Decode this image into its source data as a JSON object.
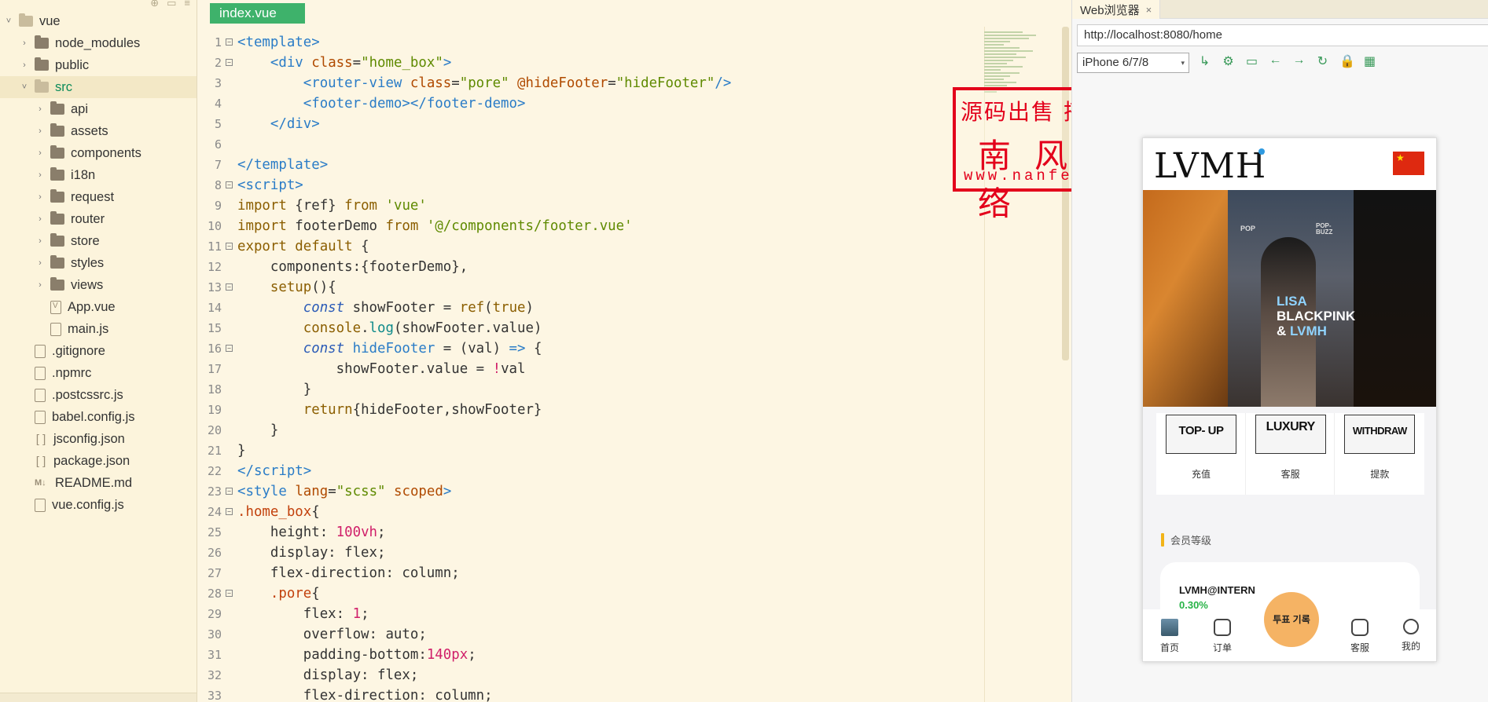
{
  "file_tree": {
    "root": "vue",
    "items": [
      {
        "label": "node_modules",
        "kind": "folder",
        "depth": 1,
        "icon": "folder-icon"
      },
      {
        "label": "public",
        "kind": "folder",
        "depth": 1,
        "icon": "folder-icon"
      },
      {
        "label": "src",
        "kind": "folder-open",
        "depth": 1,
        "icon": "folder-open-icon"
      },
      {
        "label": "api",
        "kind": "folder",
        "depth": 2,
        "icon": "folder-icon"
      },
      {
        "label": "assets",
        "kind": "folder",
        "depth": 2,
        "icon": "folder-icon"
      },
      {
        "label": "components",
        "kind": "folder",
        "depth": 2,
        "icon": "folder-icon"
      },
      {
        "label": "i18n",
        "kind": "folder",
        "depth": 2,
        "icon": "folder-icon"
      },
      {
        "label": "request",
        "kind": "folder",
        "depth": 2,
        "icon": "folder-icon"
      },
      {
        "label": "router",
        "kind": "folder",
        "depth": 2,
        "icon": "folder-icon"
      },
      {
        "label": "store",
        "kind": "folder",
        "depth": 2,
        "icon": "folder-icon"
      },
      {
        "label": "styles",
        "kind": "folder",
        "depth": 2,
        "icon": "folder-icon"
      },
      {
        "label": "views",
        "kind": "folder",
        "depth": 2,
        "icon": "folder-icon"
      },
      {
        "label": "App.vue",
        "kind": "vue",
        "depth": 2,
        "icon": "vue-file-icon"
      },
      {
        "label": "main.js",
        "kind": "file",
        "depth": 2,
        "icon": "js-file-icon"
      },
      {
        "label": ".gitignore",
        "kind": "file",
        "depth": 1,
        "icon": "file-icon"
      },
      {
        "label": ".npmrc",
        "kind": "file",
        "depth": 1,
        "icon": "file-icon"
      },
      {
        "label": ".postcssrc.js",
        "kind": "file",
        "depth": 1,
        "icon": "js-file-icon"
      },
      {
        "label": "babel.config.js",
        "kind": "file",
        "depth": 1,
        "icon": "js-file-icon"
      },
      {
        "label": "jsconfig.json",
        "kind": "json",
        "depth": 1,
        "icon": "json-file-icon"
      },
      {
        "label": "package.json",
        "kind": "json",
        "depth": 1,
        "icon": "json-file-icon"
      },
      {
        "label": "README.md",
        "kind": "md",
        "depth": 1,
        "icon": "markdown-file-icon"
      },
      {
        "label": "vue.config.js",
        "kind": "file",
        "depth": 1,
        "icon": "js-file-icon"
      }
    ]
  },
  "editor": {
    "active_tab": "index.vue",
    "lines": [
      {
        "n": "1",
        "fold": "⊟",
        "html": "<span class='t-tag'>&lt;template&gt;</span>"
      },
      {
        "n": "2",
        "fold": "⊟",
        "html": "    <span class='t-tag'>&lt;div</span> <span class='t-attr'>class</span>=<span class='t-str'>\"home_box\"</span><span class='t-tag'>&gt;</span>"
      },
      {
        "n": "3",
        "fold": "",
        "html": "        <span class='t-tag'>&lt;router-view</span> <span class='t-attr'>class</span>=<span class='t-str'>\"pore\"</span> <span class='t-attr'>@hideFooter</span>=<span class='t-str'>\"hideFooter\"</span><span class='t-tag'>/&gt;</span>"
      },
      {
        "n": "4",
        "fold": "",
        "html": "        <span class='t-tag'>&lt;footer-demo&gt;&lt;/footer-demo&gt;</span>"
      },
      {
        "n": "5",
        "fold": "",
        "html": "    <span class='t-tag'>&lt;/div&gt;</span>"
      },
      {
        "n": "6",
        "fold": "",
        "html": ""
      },
      {
        "n": "7",
        "fold": "",
        "html": "<span class='t-tag'>&lt;/template&gt;</span>"
      },
      {
        "n": "8",
        "fold": "⊟",
        "html": "<span class='t-tag'>&lt;script&gt;</span>"
      },
      {
        "n": "9",
        "fold": "",
        "html": "<span class='t-kw'>import</span> {ref} <span class='t-kw'>from</span> <span class='t-str'>'vue'</span>"
      },
      {
        "n": "10",
        "fold": "",
        "html": "<span class='t-kw'>import</span> footerDemo <span class='t-kw'>from</span> <span class='t-str'>'@/components/footer.vue'</span>"
      },
      {
        "n": "11",
        "fold": "⊟",
        "html": "<span class='t-kw'>export default</span> {"
      },
      {
        "n": "12",
        "fold": "",
        "html": "    components:{footerDemo},"
      },
      {
        "n": "13",
        "fold": "⊟",
        "html": "    <span class='t-kw'>setup</span>(){"
      },
      {
        "n": "14",
        "fold": "",
        "html": "        <span class='t-kw2'>const</span> showFooter = <span class='t-kw'>ref</span>(<span class='t-kw'>true</span>)"
      },
      {
        "n": "15",
        "fold": "",
        "html": "        <span class='t-kw'>console</span>.<span class='t-fn'>log</span>(showFooter.value)"
      },
      {
        "n": "16",
        "fold": "⊟",
        "html": "        <span class='t-kw2'>const</span> <span class='t-tag'>hideFooter</span> = (val) <span class='t-tag'>=&gt;</span> {"
      },
      {
        "n": "17",
        "fold": "",
        "html": "            showFooter.value = <span class='t-num'>!</span>val"
      },
      {
        "n": "18",
        "fold": "",
        "html": "        }"
      },
      {
        "n": "19",
        "fold": "",
        "html": "        <span class='t-kw'>return</span>{hideFooter,showFooter}"
      },
      {
        "n": "20",
        "fold": "",
        "html": "    }"
      },
      {
        "n": "21",
        "fold": "",
        "html": "}"
      },
      {
        "n": "22",
        "fold": "",
        "html": "<span class='t-tag'>&lt;/script&gt;</span>"
      },
      {
        "n": "23",
        "fold": "⊟",
        "html": "<span class='t-tag'>&lt;style</span> <span class='t-attr'>lang</span>=<span class='t-str'>\"scss\"</span> <span class='t-attr'>scoped</span><span class='t-tag'>&gt;</span>"
      },
      {
        "n": "24",
        "fold": "⊟",
        "html": "<span class='t-sel'>.home_box</span>{"
      },
      {
        "n": "25",
        "fold": "",
        "html": "    height: <span class='t-num'>100</span><span class='t-unit'>vh</span>;"
      },
      {
        "n": "26",
        "fold": "",
        "html": "    display: flex;"
      },
      {
        "n": "27",
        "fold": "",
        "html": "    flex-direction: column;"
      },
      {
        "n": "28",
        "fold": "⊟",
        "html": "    <span class='t-sel'>.pore</span>{"
      },
      {
        "n": "29",
        "fold": "",
        "html": "        flex: <span class='t-num'>1</span>;"
      },
      {
        "n": "30",
        "fold": "",
        "html": "        overflow: auto;"
      },
      {
        "n": "31",
        "fold": "",
        "html": "        padding-bottom:<span class='t-num'>140</span><span class='t-unit'>px</span>;"
      },
      {
        "n": "32",
        "fold": "",
        "html": "        display: flex;"
      },
      {
        "n": "33",
        "fold": "",
        "html": "        flex-direction: column;"
      }
    ]
  },
  "watermark": {
    "line1": "源码出售 搭建二开",
    "line2": "南风网络",
    "line3": "www.nanfengw.com"
  },
  "browser": {
    "tab_title": "Web浏览器",
    "tab_close": "×",
    "url": "http://localhost:8080/home",
    "device": "iPhone 6/7/8",
    "tools": [
      "↳",
      "⚙",
      "▭",
      "←",
      "→",
      "↻",
      "🔒",
      "▦"
    ],
    "tool_names": [
      "open-external-icon",
      "settings-icon",
      "screen-icon",
      "back-icon",
      "forward-icon",
      "reload-icon",
      "lock-icon",
      "grid-icon"
    ]
  },
  "phone": {
    "logo": "LVMH",
    "banner": {
      "pop_left": "POP",
      "pop_right": "POP-\nBUZZ",
      "line1": "LISA",
      "line2": "BLACKPINK",
      "line3_amp": "&",
      "line3_brand": "LVMH"
    },
    "quick": [
      {
        "img": "TOP- UP",
        "label": "充值"
      },
      {
        "img": "LUXURY",
        "label": "客服"
      },
      {
        "img": "WITHDRAW",
        "label": "提款"
      }
    ],
    "member_title": "会员等级",
    "card": {
      "name": "LVMH@INTERN",
      "percent": "0.30%"
    },
    "footer": [
      {
        "label": "首页",
        "icon": "home-icon"
      },
      {
        "label": "订单",
        "icon": "bag-icon"
      },
      {
        "label": "客服",
        "icon": "chat-icon"
      },
      {
        "label": "我的",
        "icon": "user-icon"
      }
    ],
    "vote_button": "투표 기록"
  }
}
